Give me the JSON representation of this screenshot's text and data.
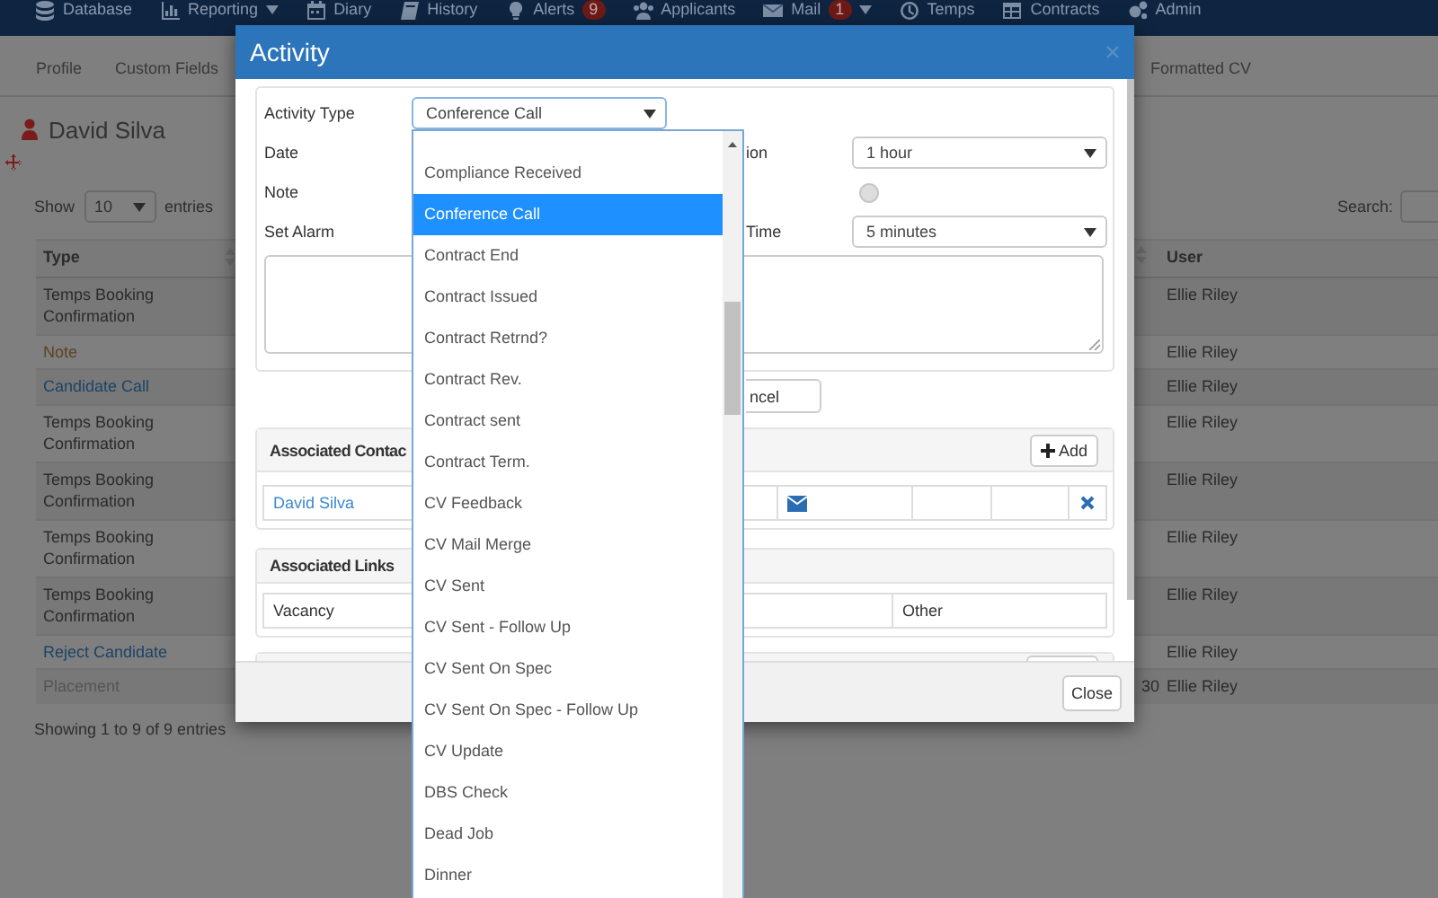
{
  "nav": {
    "items": [
      {
        "label": "Database",
        "caret": false
      },
      {
        "label": "Reporting",
        "caret": true
      },
      {
        "label": "Diary",
        "caret": false
      },
      {
        "label": "History",
        "caret": false
      },
      {
        "label": "Alerts",
        "badge": "9",
        "caret": false
      },
      {
        "label": "Applicants",
        "caret": false
      },
      {
        "label": "Mail",
        "badge": "1",
        "caret": true
      },
      {
        "label": "Temps",
        "caret": false
      },
      {
        "label": "Contracts",
        "caret": false
      },
      {
        "label": "Admin",
        "caret": false
      }
    ]
  },
  "subnav": {
    "tabs": [
      "Profile",
      "Custom Fields",
      "Formatted CV"
    ]
  },
  "profile": {
    "name": "David Silva"
  },
  "table_controls": {
    "show_label": "Show",
    "page_size": "10",
    "entries_label": "entries",
    "search_label": "Search:"
  },
  "table": {
    "columns": {
      "type": "Type",
      "user": "User"
    },
    "rows": [
      {
        "type": "Temps Booking Confirmation",
        "color": "#2b2b2b",
        "user": "Ellie Riley"
      },
      {
        "type": "Note",
        "color": "#5c4326",
        "user": "Ellie Riley"
      },
      {
        "type": "Candidate Call",
        "color": "#1c4466",
        "user": "Ellie Riley"
      },
      {
        "type": "Temps Booking Confirmation",
        "color": "#2b2b2b",
        "user": "Ellie Riley"
      },
      {
        "type": "Temps Booking Confirmation",
        "color": "#2b2b2b",
        "user": "Ellie Riley"
      },
      {
        "type": "Temps Booking Confirmation",
        "color": "#2b2b2b",
        "user": "Ellie Riley"
      },
      {
        "type": "Temps Booking Confirmation",
        "color": "#2b2b2b",
        "user": "Ellie Riley"
      },
      {
        "type": "Reject Candidate",
        "color": "#1c4466",
        "user": "Ellie Riley"
      },
      {
        "type": "Placement",
        "color": "#555555",
        "column_2": "30",
        "user": "Ellie Riley"
      }
    ]
  },
  "table_info": "Showing 1 to 9 of 9 entries",
  "modal": {
    "title": "Activity",
    "form": {
      "activity_type": {
        "label": "Activity Type",
        "value": "Conference Call"
      },
      "left_labels": [
        "Date",
        "Note",
        "Set Alarm"
      ],
      "duration": {
        "label": "ion",
        "value": "1 hour"
      },
      "radio": {
        "checked": false
      },
      "alarm_time": {
        "label": "Time",
        "value": "5 minutes"
      }
    },
    "cancel_button": "ncel",
    "contacts": {
      "title": "Associated Contac",
      "add_button": "Add",
      "rows": [
        {
          "name": "David Silva"
        }
      ]
    },
    "links": {
      "title": "Associated Links",
      "cells": [
        "Vacancy",
        "Other"
      ]
    },
    "close_button": "Close"
  },
  "dropdown": {
    "items": [
      {
        "label": "Compliance Received",
        "selected": false
      },
      {
        "label": "Conference Call",
        "selected": true
      },
      {
        "label": "Contract End",
        "selected": false
      },
      {
        "label": "Contract Issued",
        "selected": false
      },
      {
        "label": "Contract Retrnd?",
        "selected": false
      },
      {
        "label": "Contract Rev.",
        "selected": false
      },
      {
        "label": "Contract sent",
        "selected": false
      },
      {
        "label": "Contract Term.",
        "selected": false
      },
      {
        "label": "CV Feedback",
        "selected": false
      },
      {
        "label": "CV Mail Merge",
        "selected": false
      },
      {
        "label": "CV Sent",
        "selected": false
      },
      {
        "label": "CV Sent - Follow Up",
        "selected": false
      },
      {
        "label": "CV Sent On Spec",
        "selected": false
      },
      {
        "label": "CV Sent On Spec - Follow Up",
        "selected": false
      },
      {
        "label": "CV Update",
        "selected": false
      },
      {
        "label": "DBS Check",
        "selected": false
      },
      {
        "label": "Dead Job",
        "selected": false
      },
      {
        "label": "Dinner",
        "selected": false
      }
    ]
  }
}
